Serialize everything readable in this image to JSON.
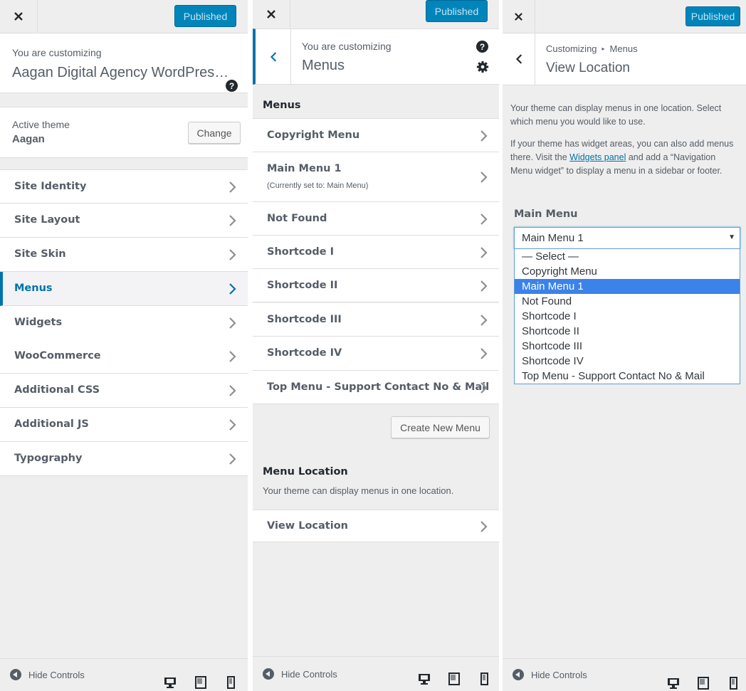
{
  "colors": {
    "accent": "#0073aa",
    "publish": "#0085ba",
    "selected_option": "#3b82e9"
  },
  "panel_left": {
    "publish_label": "Published",
    "customizing_label": "You are customizing",
    "site_title": "Aagan Digital Agency WordPres…",
    "active_theme_label": "Active theme",
    "active_theme_name": "Aagan",
    "change_label": "Change",
    "sections": [
      "Site Identity",
      "Site Layout",
      "Site Skin",
      "Menus",
      "Widgets",
      "WooCommerce",
      "Additional CSS",
      "Additional JS",
      "Typography"
    ],
    "hide_controls": "Hide Controls"
  },
  "panel_menus": {
    "publish_label": "Published",
    "customizing_label": "You are customizing",
    "title": "Menus",
    "menus_heading": "Menus",
    "menus": [
      {
        "label": "Copyright Menu",
        "sub": ""
      },
      {
        "label": "Main Menu 1",
        "sub": "(Currently set to: Main Menu)"
      },
      {
        "label": "Not Found",
        "sub": ""
      },
      {
        "label": "Shortcode I",
        "sub": ""
      },
      {
        "label": "Shortcode II",
        "sub": ""
      },
      {
        "label": "Shortcode III",
        "sub": ""
      },
      {
        "label": "Shortcode IV",
        "sub": ""
      },
      {
        "label": "Top Menu - Support Contact No & Mail",
        "sub": ""
      }
    ],
    "create_label": "Create New Menu",
    "location_heading": "Menu Location",
    "location_desc": "Your theme can display menus in one location.",
    "view_location": "View Location",
    "hide_controls": "Hide Controls"
  },
  "panel_location": {
    "publish_label": "Published",
    "crumb_root": "Customizing",
    "crumb_child": "Menus",
    "title": "View Location",
    "desc1": "Your theme can display menus in one location. Select which menu you would like to use.",
    "desc2_pre": "If your theme has widget areas, you can also add menus there. Visit the ",
    "desc2_link": "Widgets panel",
    "desc2_post": " and add a “Navigation Menu widget” to display a menu in a sidebar or footer.",
    "field_label": "Main Menu",
    "selected_value": "Main Menu 1",
    "options": [
      "— Select —",
      "Copyright Menu",
      "Main Menu 1",
      "Not Found",
      "Shortcode I",
      "Shortcode II",
      "Shortcode III",
      "Shortcode IV",
      "Top Menu - Support Contact No & Mail"
    ],
    "highlighted_option": "Main Menu 1",
    "hide_controls": "Hide Controls"
  }
}
